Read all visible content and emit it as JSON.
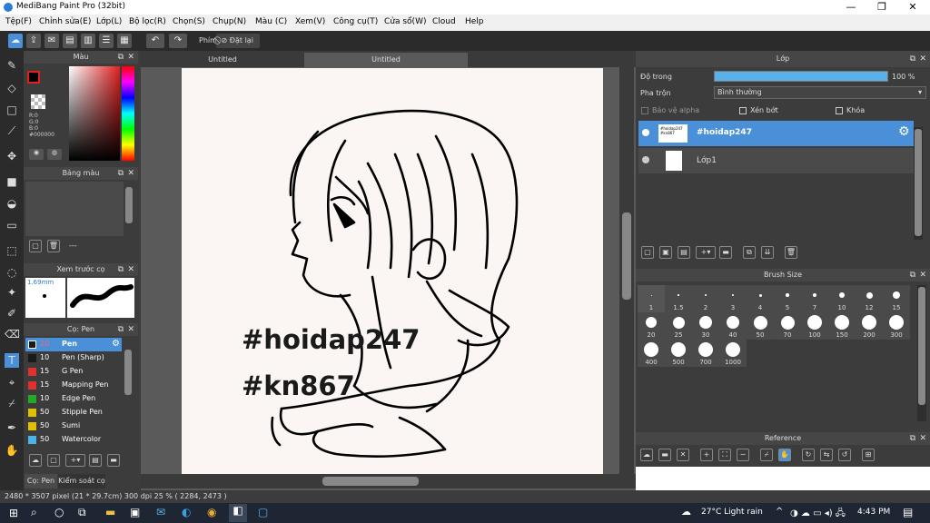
{
  "window": {
    "title": "MediBang Paint Pro (32bit)",
    "min": "—",
    "max": "❐",
    "close": "✕"
  },
  "menu": [
    "Tệp(F)",
    "Chỉnh sửa(E)",
    "Lớp(L)",
    "Bộ lọc(R)",
    "Chọn(S)",
    "Chụp(N)",
    "Màu (C)",
    "Xem(V)",
    "Công cụ(T)",
    "Cửa sổ(W)",
    "Cloud",
    "Help"
  ],
  "toolbar": {
    "ruler_label": "Phím",
    "reset_label": "Đặt lại"
  },
  "color_panel": {
    "title": "Màu",
    "r": "R:0",
    "g": "G:0",
    "b": "B:0",
    "hex": "#000000",
    "fg": "#000000",
    "bg": "#ffffff",
    "accent_red": "#e02020"
  },
  "palette_panel": {
    "title": "Bảng màu",
    "count": "---"
  },
  "preview_panel": {
    "title": "Xem trước cọ",
    "size": "1.69mm"
  },
  "brush_panel": {
    "title": "Cọ: Pen",
    "items": [
      {
        "size": "20",
        "name": "Pen",
        "color": "#1a1a1a"
      },
      {
        "size": "10",
        "name": "Pen (Sharp)",
        "color": "#1a1a1a"
      },
      {
        "size": "15",
        "name": "G Pen",
        "color": "#e03030"
      },
      {
        "size": "15",
        "name": "Mapping Pen",
        "color": "#e03030"
      },
      {
        "size": "10",
        "name": "Edge Pen",
        "color": "#22aa22"
      },
      {
        "size": "50",
        "name": "Stipple Pen",
        "color": "#e0c000"
      },
      {
        "size": "50",
        "name": "Sumi",
        "color": "#e0c000"
      },
      {
        "size": "50",
        "name": "Watercolor",
        "color": "#4ab4e8"
      }
    ],
    "tab1": "Cọ: Pen",
    "tab2": "Kiểm soát cọ"
  },
  "canvas": {
    "tab1": "Untitled",
    "tab2": "Untitled",
    "text1": "#hoidap247",
    "text2": "#kn867"
  },
  "layer_panel": {
    "title": "Lớp",
    "opacity_label": "Độ trong",
    "opacity": "100 %",
    "opacity_value": 1.0,
    "blend_label": "Pha trộn",
    "blend_value": "Bình thường",
    "alpha_lock": "Bảo vệ alpha",
    "clip": "Xén bớt",
    "lock": "Khóa",
    "layers": [
      {
        "name": "#hoidap247",
        "selected": true
      },
      {
        "name": "Lớp1",
        "selected": false
      }
    ]
  },
  "brush_size_panel": {
    "title": "Brush Size",
    "sizes": [
      "1",
      "1.5",
      "2",
      "3",
      "4",
      "5",
      "7",
      "10",
      "12",
      "15",
      "20",
      "25",
      "30",
      "40",
      "50",
      "70",
      "100",
      "150",
      "200",
      "300",
      "400",
      "500",
      "700",
      "1000"
    ]
  },
  "reference_panel": {
    "title": "Reference"
  },
  "status": {
    "info": "2480 * 3507 pixel  (21 * 29.7cm)  300 dpi  25 %  ( 2284, 2473 )"
  },
  "taskbar": {
    "weather": "27°C  Light rain",
    "time": "4:43 PM"
  }
}
